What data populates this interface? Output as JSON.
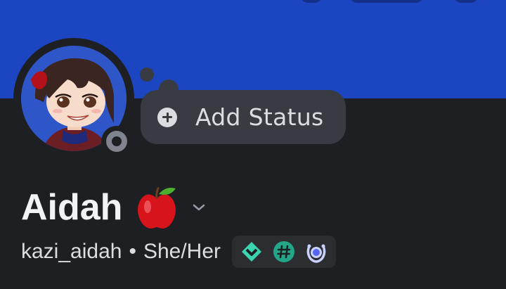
{
  "colors": {
    "banner": "#1c45c1",
    "background": "#1e1f22",
    "bubble": "#393b42",
    "status_offline": "#80848e",
    "badge_teal": "#3bd3b0"
  },
  "status": {
    "label": "Add Status",
    "icon": "plus-circle-icon"
  },
  "profile": {
    "display_name": "Aidah",
    "name_emoji": "red-apple",
    "username": "kazi_aidah",
    "separator": "•",
    "pronouns": "She/Her",
    "presence": "offline"
  },
  "badges": [
    {
      "name": "hypesquad-balance-badge"
    },
    {
      "name": "hashtag-badge"
    },
    {
      "name": "laurel-badge"
    }
  ]
}
